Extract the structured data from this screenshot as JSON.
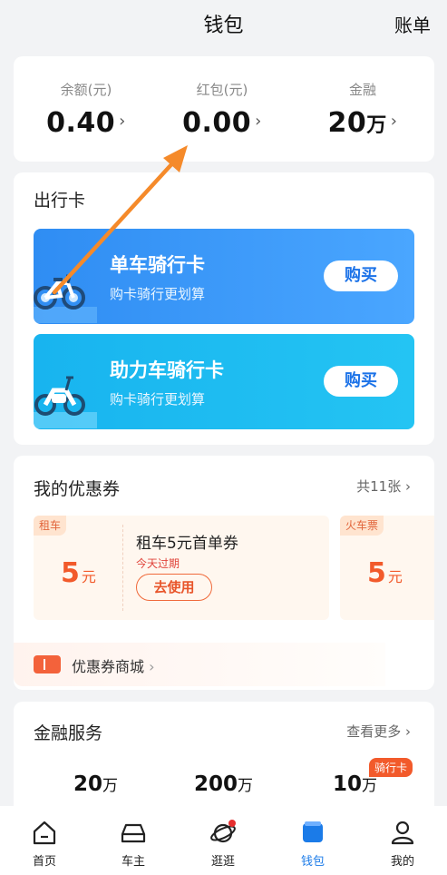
{
  "header": {
    "title": "钱包",
    "bill": "账单"
  },
  "balance": [
    {
      "label": "余额(元)",
      "value": "0.40",
      "unit": ""
    },
    {
      "label": "红包(元)",
      "value": "0.00",
      "unit": ""
    },
    {
      "label": "金融",
      "value": "20",
      "unit": "万"
    }
  ],
  "chevron": "›",
  "travel": {
    "title": "出行卡",
    "cards": [
      {
        "name": "单车骑行卡",
        "sub": "购卡骑行更划算",
        "buy": "购买",
        "color_from": "#2f8df3",
        "color_to": "#4aa6ff"
      },
      {
        "name": "助力车骑行卡",
        "sub": "购卡骑行更划算",
        "buy": "购买",
        "color_from": "#18b4ef",
        "color_to": "#24c4f3"
      }
    ]
  },
  "coupons": {
    "title": "我的优惠券",
    "more": "共11张",
    "items": [
      {
        "tag": "租车",
        "amount": "5",
        "unit": "元",
        "name": "租车5元首单券",
        "expire": "今天过期",
        "action": "去使用"
      },
      {
        "tag": "火车票",
        "amount": "5",
        "unit": "元"
      }
    ],
    "mall": "优惠券商城"
  },
  "finance": {
    "title": "金融服务",
    "more": "查看更多",
    "values": [
      {
        "value": "20",
        "unit": "万"
      },
      {
        "value": "200",
        "unit": "万"
      },
      {
        "value": "10",
        "unit": "万"
      }
    ],
    "badge": "骑行卡"
  },
  "tabs": [
    {
      "label": "首页",
      "icon": "home-icon"
    },
    {
      "label": "车主",
      "icon": "car-icon"
    },
    {
      "label": "逛逛",
      "icon": "planet-icon"
    },
    {
      "label": "钱包",
      "icon": "wallet-icon",
      "active": true
    },
    {
      "label": "我的",
      "icon": "user-icon"
    }
  ],
  "colors": {
    "accent": "#1b7be8",
    "orange": "#f25a2b",
    "annotation_arrow": "#f58a2a"
  }
}
